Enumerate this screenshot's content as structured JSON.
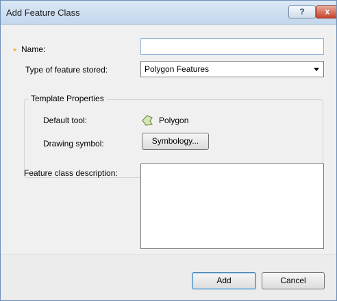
{
  "window": {
    "title": "Add Feature Class",
    "help_label": "?",
    "close_label": "x"
  },
  "form": {
    "required_marker": "*",
    "name_label": "Name:",
    "name_value": "",
    "type_label": "Type of feature stored:",
    "type_value": "Polygon Features",
    "template": {
      "title": "Template Properties",
      "default_tool_label": "Default tool:",
      "default_tool_icon": "polygon-tool-icon",
      "default_tool_value": "Polygon",
      "drawing_symbol_label": "Drawing symbol:",
      "symbology_button": "Symbology..."
    },
    "description_label": "Feature class description:",
    "description_value": ""
  },
  "footer": {
    "add_button": "Add",
    "cancel_button": "Cancel"
  },
  "colors": {
    "required_marker": "#f0a020",
    "title_bar": "#c3d7ec",
    "close_button": "#c7432a"
  }
}
